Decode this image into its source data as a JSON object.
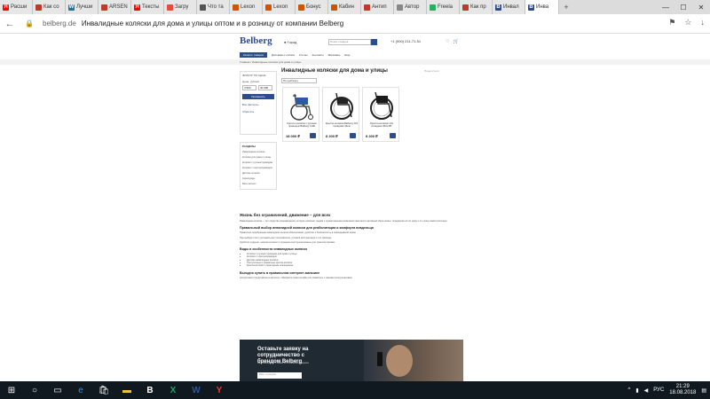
{
  "tabs": [
    {
      "label": "Расши",
      "icon_color": "#ff0000",
      "icon_glyph": "Я"
    },
    {
      "label": "Как со",
      "icon_color": "#c0392b",
      "icon_glyph": ""
    },
    {
      "label": "Лучши",
      "icon_color": "#21759b",
      "icon_glyph": "W"
    },
    {
      "label": "ARSEN",
      "icon_color": "#c0392b",
      "icon_glyph": ""
    },
    {
      "label": "Тексты",
      "icon_color": "#ff0000",
      "icon_glyph": "Я"
    },
    {
      "label": "Загру",
      "icon_color": "#e74c3c",
      "icon_glyph": ""
    },
    {
      "label": "Что та",
      "icon_color": "#555555",
      "icon_glyph": ""
    },
    {
      "label": "Lexon",
      "icon_color": "#d35400",
      "icon_glyph": ""
    },
    {
      "label": "Lexon",
      "icon_color": "#d35400",
      "icon_glyph": ""
    },
    {
      "label": "Бонус",
      "icon_color": "#d35400",
      "icon_glyph": ""
    },
    {
      "label": "Кабин",
      "icon_color": "#d35400",
      "icon_glyph": ""
    },
    {
      "label": "Антип",
      "icon_color": "#c0392b",
      "icon_glyph": ""
    },
    {
      "label": "Автор",
      "icon_color": "#888888",
      "icon_glyph": ""
    },
    {
      "label": "Freela",
      "icon_color": "#27ae60",
      "icon_glyph": ""
    },
    {
      "label": "Как пр",
      "icon_color": "#c0392b",
      "icon_glyph": ""
    },
    {
      "label": "Инвал",
      "icon_color": "#2d4c8c",
      "icon_glyph": "B"
    },
    {
      "label": "Инва",
      "icon_color": "#2d4c8c",
      "icon_glyph": "B"
    }
  ],
  "address": {
    "url": "belberg.de",
    "title": "Инвалидные коляски для дома и улицы оптом и в розницу от компании Belberg"
  },
  "site": {
    "logo": "Belberg",
    "city": "Город",
    "search_placeholder": "Поиск товаров",
    "phone": "+1 (000) 211-71-51",
    "catalog_button": "Каталог товаров",
    "menu": [
      "Доставка и оплата",
      "Кто мы",
      "Контакты",
      "Магазины",
      "Еще"
    ],
    "breadcrumb": "Главная  /  Инвалидные коляски для дома и улицы",
    "heading": "Инвалидные коляски для дома и улицы",
    "share": "Поделиться",
    "sort": "По рейтингу"
  },
  "filter": {
    "title": "ФИЛЬТР ПО ЦЕНЕ",
    "label": "Цена, рублей",
    "from": "4 500",
    "to": "40 000",
    "apply": "Применить",
    "link1": "Все фильтры",
    "link2": "Сбросить"
  },
  "sidebar": {
    "title": "РАЗДЕЛЫ",
    "items": [
      "Инвалидные коляски",
      "Коляски для дома и улицы",
      "Коляски с ручным приводом",
      "Коляски с электроприводом",
      "Детские коляски",
      "Аксессуары"
    ],
    "more": "Весь каталог"
  },
  "products": [
    {
      "name": "Кресло-коляска с ручным приводом Belberg 111E",
      "price": "18 000 ₽"
    },
    {
      "name": "Кресло-коляска Belberg 101 складная 46см",
      "price": "8 200 ₽"
    },
    {
      "name": "Кресло-коляска 101 складная 46см ВТ",
      "price": "8 200 ₽"
    }
  ],
  "article": {
    "h2": "Жизнь без ограничений, движение – для всех",
    "p1": "Инвалидная коляска — это средство передвижения, которое помогает людям с ограниченными возможностями вести активный образ жизни, передвигаться по дому и по улице самостоятельно.",
    "h3a": "Правильный выбор инвалидной коляски для реабилитации и комфорта владельца",
    "p2": "Правильно подобранная инвалидная коляска обеспечивает удобство и безопасность в повседневной жизни.",
    "p3": "При выборе стоит учитывать вес пользователя, условия эксплуатации и тип привода.",
    "p4": "Удобство сидения, ширина коляски и складная конструкция важны для транспортировки.",
    "h3b": "Виды и особенности инвалидных колясок",
    "list": [
      "Коляски с ручным приводом для дома и улицы",
      "Коляски с электроприводом",
      "Детские инвалидные коляски",
      "Прогулочные и комнатные кресла-коляски",
      "Кресла-коляски с санитарным оснащением"
    ],
    "h3c": "Выгодно купить в правильном интернет-магазине",
    "p5": "Ассортимент представлен в каталоге. Оформите заказ онлайн или свяжитесь с нашими консультантами."
  },
  "promo": {
    "title": "Оставьте заявку на сотрудничество с брендом Belberg",
    "subtitle": "Мы свяжемся с вами в ближайшее время",
    "input_placeholder": "Ваш телефон"
  },
  "taskbar": {
    "lang": "РУС",
    "time": "21:29",
    "date": "18.08.2018"
  }
}
